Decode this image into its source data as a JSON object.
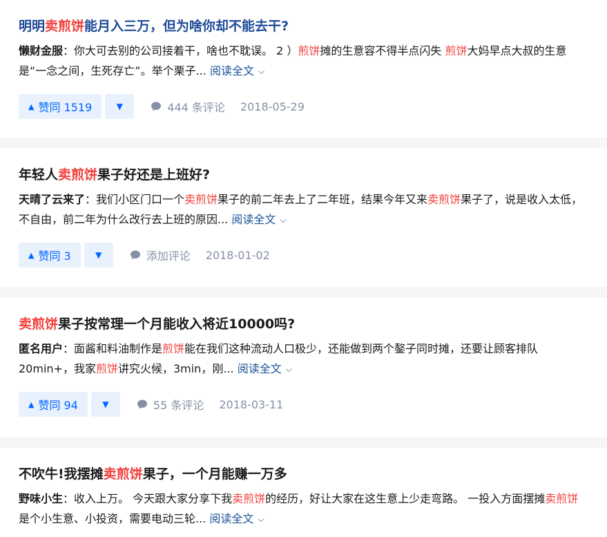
{
  "colors": {
    "accent": "#0066ff",
    "highlight": "#f1403c",
    "link": "#175199",
    "meta": "#8590a6"
  },
  "items": [
    {
      "title_pre": "明明",
      "title_hl": "卖煎饼",
      "title_post": "能月入三万，但为啥你却不能去干?",
      "author": "懒财金服",
      "ex": [
        "：你大可去别的公司接着干，啥也不耽误。 2 ）",
        "煎饼",
        "摊的生意容不得半点闪失 ",
        "煎饼",
        "大妈早点大叔的生意是“一念之间，生死存亡”。举个栗子..."
      ],
      "read_more": "阅读全文",
      "votes": "赞同 1519",
      "comments": "444 条评论",
      "date": "2018-05-29"
    },
    {
      "title_pre": "年轻人",
      "title_hl": "卖煎饼",
      "title_post": "果子好还是上班好?",
      "author": "天晴了云来了",
      "ex": [
        "：我们小区门口一个",
        "卖煎饼",
        "果子的前二年去上了二年班，结果今年又来",
        "卖煎饼",
        "果子了，说是收入太低，不自由，前二年为什么改行去上班的原因..."
      ],
      "read_more": "阅读全文",
      "votes": "赞同 3",
      "comments": "添加评论",
      "date": "2018-01-02"
    },
    {
      "title_pre": "",
      "title_hl": "卖煎饼",
      "title_post": "果子按常理一个月能收入将近10000吗?",
      "author": "匿名用户",
      "ex": [
        "：面酱和料油制作是",
        "煎饼",
        "能在我们这种流动人口极少，还能做到两个鏊子同时摊，还要让顾客排队20min+，我家",
        "煎饼",
        "讲究火候，3min，刚..."
      ],
      "read_more": "阅读全文",
      "votes": "赞同 94",
      "comments": "55 条评论",
      "date": "2018-03-11"
    },
    {
      "title_pre": "不吹牛!我摆摊",
      "title_hl": "卖煎饼",
      "title_post": "果子，一个月能赚一万多",
      "author": "野味小生",
      "ex": [
        "：收入上万。 今天跟大家分享下我",
        "卖煎饼",
        "的经历，好让大家在这生意上少走弯路。 一投入方面摆摊",
        "卖煎饼",
        "是个小生意、小投资，需要电动三轮..."
      ],
      "read_more": "阅读全文"
    }
  ]
}
